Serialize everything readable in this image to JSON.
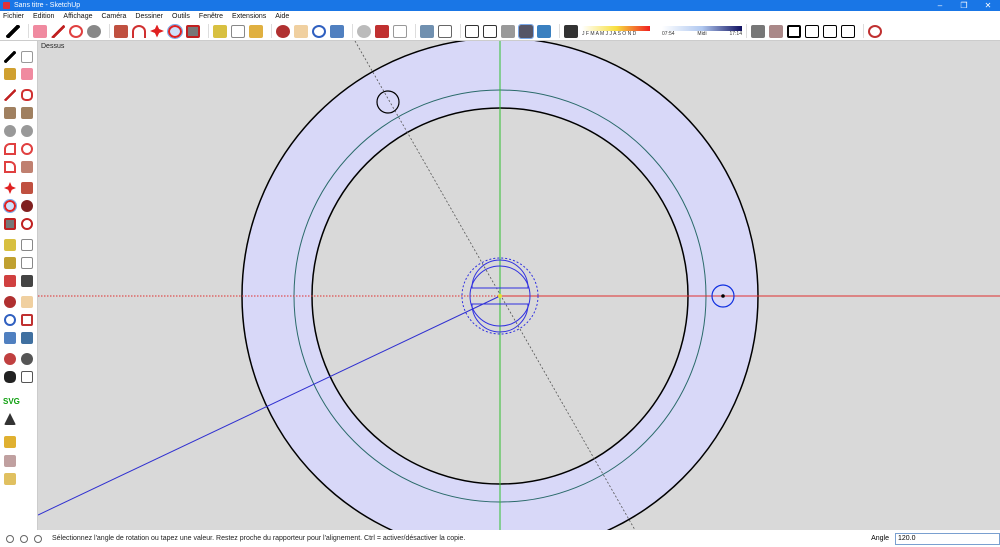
{
  "window": {
    "title": "Sans titre - SketchUp",
    "minimize": "–",
    "maximize": "❐",
    "close": "✕"
  },
  "menu": [
    "Fichier",
    "Edition",
    "Affichage",
    "Caméra",
    "Dessiner",
    "Outils",
    "Fenêtre",
    "Extensions",
    "Aide"
  ],
  "shadows": {
    "months": "J F M A M J J A S O N D",
    "time_start": "07:54",
    "time_mid": "Midi",
    "time_end": "17:14"
  },
  "viewport": {
    "label": "Dessus"
  },
  "left_toolbar": {
    "svg_label": "SVG"
  },
  "status": {
    "message": "Sélectionnez l'angle de rotation ou tapez une valeur.  Restez proche du rapporteur pour l'alignement. Ctrl = activer/désactiver la copie.",
    "measure_label": "Angle",
    "measure_value": "120.0"
  }
}
